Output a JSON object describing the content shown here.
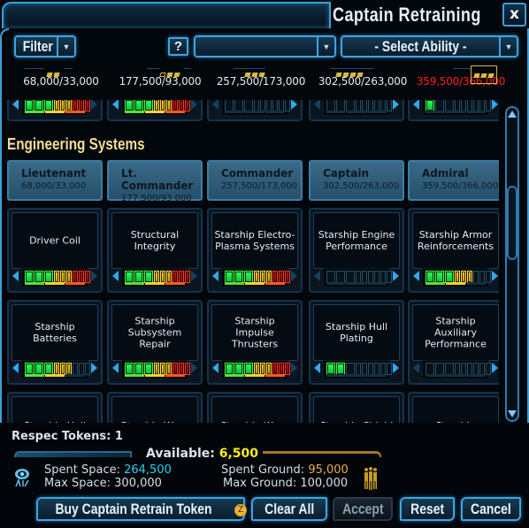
{
  "window": {
    "title": "Captain Retraining",
    "close_label": "x"
  },
  "toolbar": {
    "filter_label": "Filter",
    "help_label": "?",
    "combo_value": "",
    "select_ability_label": "- Select Ability -"
  },
  "rank_summary": [
    {
      "rank": "Lieutenant",
      "pips": "2 filled",
      "value": "68,000/33,000",
      "over_limit": false
    },
    {
      "rank": "Lt. Commander",
      "pips": "1 hollow + 2 filled",
      "value": "177,500/93,000",
      "over_limit": false
    },
    {
      "rank": "Commander",
      "pips": "3 filled",
      "value": "257,500/173,000",
      "over_limit": false
    },
    {
      "rank": "Captain",
      "pips": "4 filled",
      "value": "302,500/263,000",
      "over_limit": false
    },
    {
      "rank": "Admiral",
      "pips": "boxed 3",
      "value": "359,500/366,000",
      "over_limit": true
    }
  ],
  "top_partial_row": [
    {
      "points": 9,
      "left_active": true,
      "right_active": false
    },
    {
      "points": 9,
      "left_active": true,
      "right_active": false
    },
    {
      "points": 0,
      "left_active": false,
      "right_active": true
    },
    {
      "points": 0,
      "left_active": false,
      "right_active": true
    },
    {
      "points": 1,
      "left_active": true,
      "right_active": true
    }
  ],
  "section": {
    "title": "Engineering Systems",
    "ranks": [
      {
        "name": "Lieutenant",
        "value": "68,000/33,000"
      },
      {
        "name": "Lt. Commander",
        "value": "177,500/93,000"
      },
      {
        "name": "Commander",
        "value": "257,500/173,000"
      },
      {
        "name": "Captain",
        "value": "302,500/263,000"
      },
      {
        "name": "Admiral",
        "value": "359,500/366,000"
      }
    ],
    "skills_row1": [
      {
        "name": "Driver Coil",
        "points": 9,
        "max_points": 9
      },
      {
        "name": "Structural Integrity",
        "points": 9,
        "max_points": 9
      },
      {
        "name": "Starship Electro-Plasma Systems",
        "points": 9,
        "max_points": 9
      },
      {
        "name": "Starship Engine Performance",
        "points": 0,
        "max_points": 9
      },
      {
        "name": "Starship Armor Reinforcements",
        "points": 6,
        "max_points": 9
      }
    ],
    "skills_row2": [
      {
        "name": "Starship Batteries",
        "points": 6,
        "max_points": 9
      },
      {
        "name": "Starship Subsystem Repair",
        "points": 9,
        "max_points": 9
      },
      {
        "name": "Starship Impulse Thrusters",
        "points": 9,
        "max_points": 9
      },
      {
        "name": "Starship Hull Plating",
        "points": 2,
        "max_points": 9
      },
      {
        "name": "Starship Auxiliary Performance",
        "points": 0,
        "max_points": 9
      }
    ],
    "skills_row3_partial": [
      {
        "name": "Starship Hull"
      },
      {
        "name": "Starship Warp"
      },
      {
        "name": "Starship Warp"
      },
      {
        "name": "Starship Shield"
      },
      {
        "name": "Starship Weapon"
      }
    ]
  },
  "footer": {
    "respec_tokens_label": "Respec Tokens: 1",
    "available_label": "Available:",
    "available_value": "6,500",
    "spent_space_label": "Spent Space:",
    "spent_space_value": "264,500",
    "max_space_label": "Max Space:",
    "max_space_value": "300,000",
    "spent_ground_label": "Spent Ground:",
    "spent_ground_value": "95,000",
    "max_ground_label": "Max Ground:",
    "max_ground_value": "100,000",
    "space_icon": "starfleet-space-icon",
    "ground_icon": "away-team-ground-icon"
  },
  "buttons": {
    "buy_token": "Buy Captain Retrain Token",
    "zen_icon": "Z",
    "clear_all": "Clear All",
    "accept": "Accept",
    "reset": "Reset",
    "cancel": "Cancel"
  },
  "colors": {
    "accent": "#3aa0d8",
    "section_title": "#f3dc97",
    "over_limit": "#ff1e1e",
    "available": "#f6ee1a",
    "space_value": "#1ed5f2",
    "ground_value": "#e2b04b"
  }
}
